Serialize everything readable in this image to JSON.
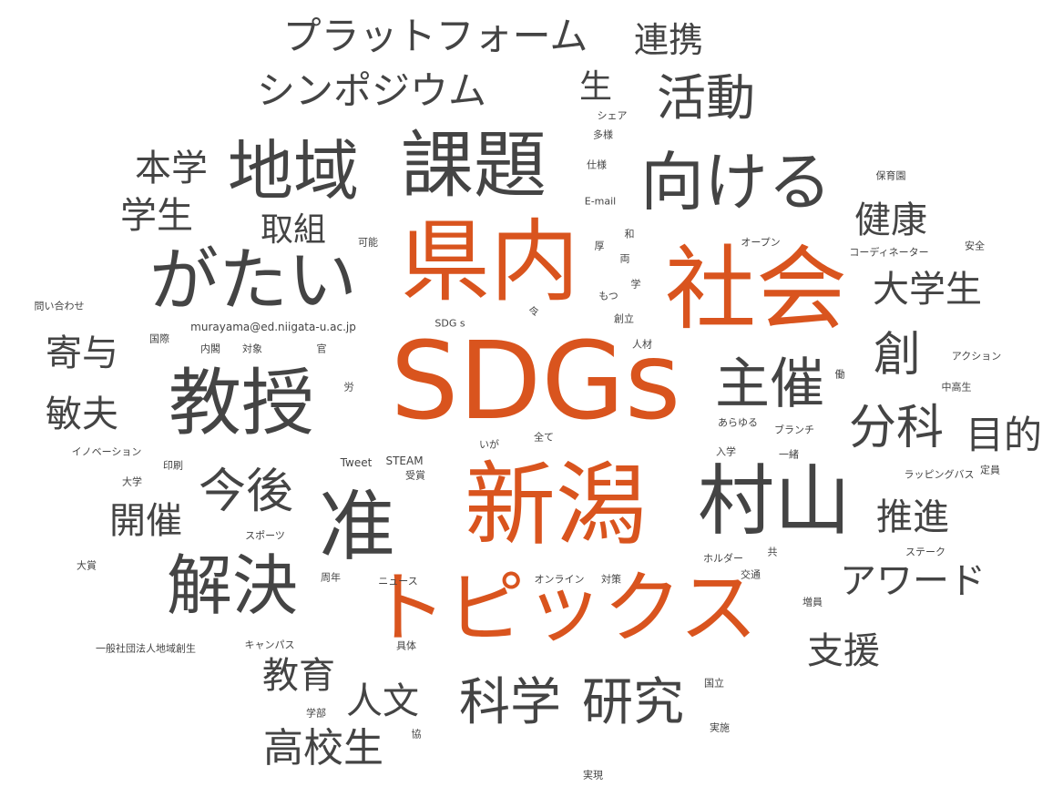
{
  "colors": {
    "highlight": "#d9541e",
    "normal": "#444444",
    "background": "#ffffff"
  },
  "words": [
    {
      "text": "SDGs",
      "hl": true
    },
    {
      "text": "新潟",
      "hl": true
    },
    {
      "text": "県内",
      "hl": true
    },
    {
      "text": "社会",
      "hl": true
    },
    {
      "text": "トピックス",
      "hl": true
    },
    {
      "text": "課題"
    },
    {
      "text": "地域"
    },
    {
      "text": "向ける"
    },
    {
      "text": "がたい"
    },
    {
      "text": "教授"
    },
    {
      "text": "准"
    },
    {
      "text": "村山"
    },
    {
      "text": "解決"
    },
    {
      "text": "プラットフォーム"
    },
    {
      "text": "シンポジウム"
    },
    {
      "text": "活動"
    },
    {
      "text": "連携"
    },
    {
      "text": "生"
    },
    {
      "text": "本学"
    },
    {
      "text": "学生"
    },
    {
      "text": "取組"
    },
    {
      "text": "健康"
    },
    {
      "text": "大学生"
    },
    {
      "text": "創"
    },
    {
      "text": "主催"
    },
    {
      "text": "分科"
    },
    {
      "text": "目的"
    },
    {
      "text": "寄与"
    },
    {
      "text": "敏夫"
    },
    {
      "text": "今後"
    },
    {
      "text": "開催"
    },
    {
      "text": "推進"
    },
    {
      "text": "アワード"
    },
    {
      "text": "支援"
    },
    {
      "text": "教育"
    },
    {
      "text": "人文"
    },
    {
      "text": "科学"
    },
    {
      "text": "研究"
    },
    {
      "text": "高校生"
    },
    {
      "text": "シェア"
    },
    {
      "text": "多様"
    },
    {
      "text": "仕様"
    },
    {
      "text": "E-mail"
    },
    {
      "text": "保育園"
    },
    {
      "text": "和"
    },
    {
      "text": "可能"
    },
    {
      "text": "厚"
    },
    {
      "text": "オープン"
    },
    {
      "text": "安全"
    },
    {
      "text": "両"
    },
    {
      "text": "コーディネーター"
    },
    {
      "text": "問い合わせ"
    },
    {
      "text": "もつ"
    },
    {
      "text": "学"
    },
    {
      "text": "令"
    },
    {
      "text": "創立"
    },
    {
      "text": "SDG s"
    },
    {
      "text": "murayama@ed.niigata-u.ac.jp"
    },
    {
      "text": "国際"
    },
    {
      "text": "内閣"
    },
    {
      "text": "対象"
    },
    {
      "text": "官"
    },
    {
      "text": "人材"
    },
    {
      "text": "アクション"
    },
    {
      "text": "働"
    },
    {
      "text": "中高生"
    },
    {
      "text": "労"
    },
    {
      "text": "あらゆる"
    },
    {
      "text": "ブランチ"
    },
    {
      "text": "全て"
    },
    {
      "text": "いが"
    },
    {
      "text": "イノベーション"
    },
    {
      "text": "入学"
    },
    {
      "text": "一緒"
    },
    {
      "text": "Tweet"
    },
    {
      "text": "STEAM"
    },
    {
      "text": "受賞"
    },
    {
      "text": "印刷"
    },
    {
      "text": "ラッピングバス"
    },
    {
      "text": "定員"
    },
    {
      "text": "大学"
    },
    {
      "text": "スポーツ"
    },
    {
      "text": "ホルダー"
    },
    {
      "text": "共"
    },
    {
      "text": "ステーク"
    },
    {
      "text": "大賞"
    },
    {
      "text": "周年"
    },
    {
      "text": "ニュース"
    },
    {
      "text": "オンライン"
    },
    {
      "text": "対策"
    },
    {
      "text": "交通"
    },
    {
      "text": "増員"
    },
    {
      "text": "一般社団法人地域創生"
    },
    {
      "text": "キャンパス"
    },
    {
      "text": "具体"
    },
    {
      "text": "国立"
    },
    {
      "text": "学部"
    },
    {
      "text": "協"
    },
    {
      "text": "実施"
    },
    {
      "text": "実現"
    }
  ]
}
